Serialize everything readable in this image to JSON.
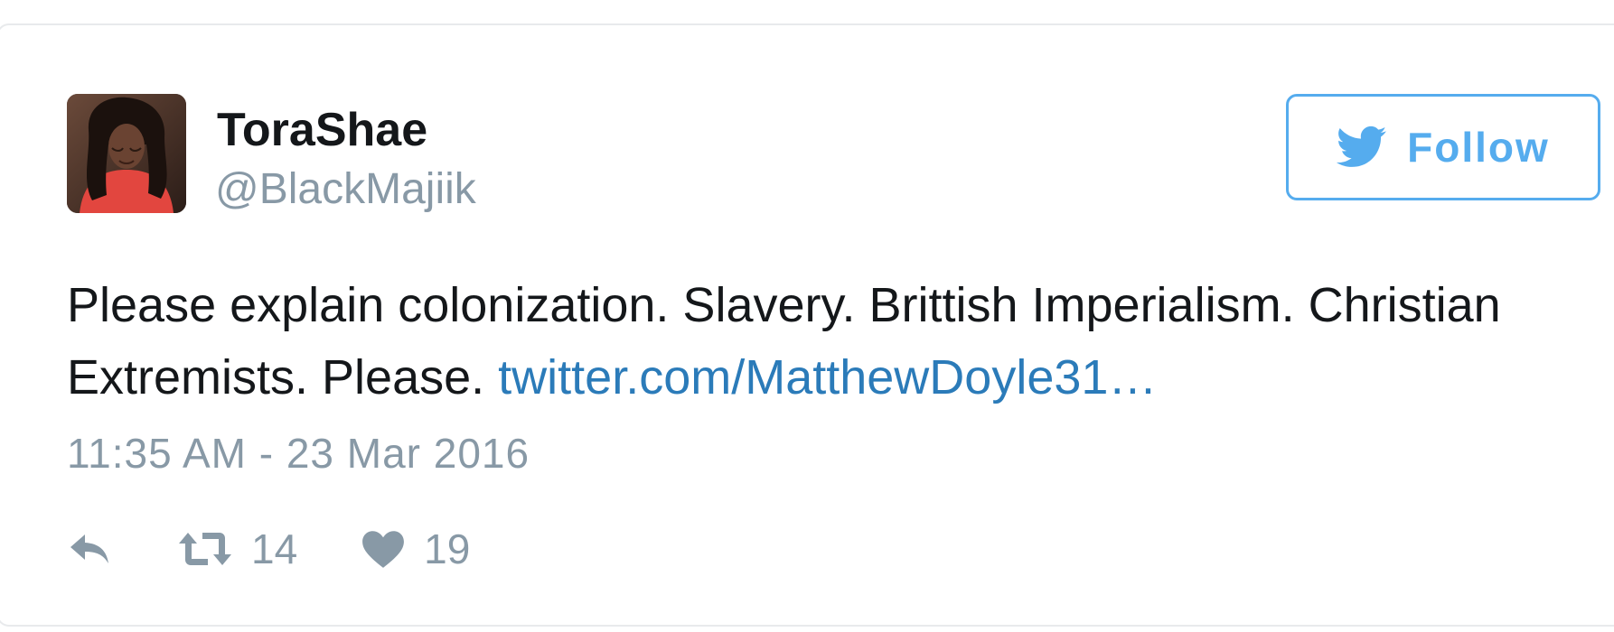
{
  "tweet": {
    "author": {
      "display_name": "ToraShae",
      "handle": "@BlackMajiik",
      "avatar_icon": "user-avatar-photo"
    },
    "follow_button": {
      "label": "Follow",
      "icon": "twitter-bird-icon",
      "color": "#55acee"
    },
    "text_line_1": "Please explain colonization. Slavery. Brittish Imperialism. Christian",
    "text_line_2_prefix": "Extremists. Please.",
    "link_text": "twitter.com/MatthewDoyle31…",
    "link_color": "#2b7bb9",
    "timestamp": "11:35 AM - 23 Mar 2016",
    "actions": {
      "reply_icon": "reply-icon",
      "retweet_icon": "retweet-icon",
      "retweet_count": "14",
      "like_icon": "heart-icon",
      "like_count": "19"
    }
  }
}
